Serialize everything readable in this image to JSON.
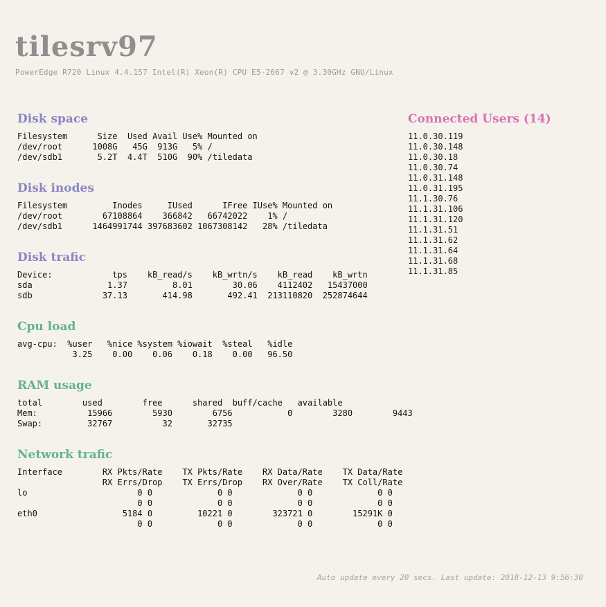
{
  "header": {
    "hostname": "tilesrv97",
    "sysinfo": "PowerEdge R720 Linux 4.4.157 Intel(R) Xeon(R) CPU E5-2667 v2 @ 3.30GHz GNU/Linux"
  },
  "disk_space": {
    "title": "Disk space",
    "text": "Filesystem      Size  Used Avail Use% Mounted on\n/dev/root      1008G   45G  913G   5% /\n/dev/sdb1       5.2T  4.4T  510G  90% /tiledata"
  },
  "disk_inodes": {
    "title": "Disk inodes",
    "text": "Filesystem         Inodes     IUsed      IFree IUse% Mounted on\n/dev/root        67108864    366842   66742022    1% /\n/dev/sdb1      1464991744 397683602 1067308142   28% /tiledata"
  },
  "disk_trafic": {
    "title": "Disk trafic",
    "text": "Device:            tps    kB_read/s    kB_wrtn/s    kB_read    kB_wrtn\nsda               1.37         8.01        30.06    4112402   15437000\nsdb              37.13       414.98       492.41  213110820  252874644"
  },
  "cpu_load": {
    "title": "Cpu load",
    "text": "avg-cpu:  %user   %nice %system %iowait  %steal   %idle\n           3.25    0.00    0.06    0.18    0.00   96.50"
  },
  "ram_usage": {
    "title": "RAM usage",
    "text": "total        used        free      shared  buff/cache   available\nMem:          15966        5930        6756           0        3280        9443\nSwap:         32767          32       32735"
  },
  "network_trafic": {
    "title": "Network trafic",
    "text": "Interface        RX Pkts/Rate    TX Pkts/Rate    RX Data/Rate    TX Data/Rate\n                 RX Errs/Drop    TX Errs/Drop    RX Over/Rate    TX Coll/Rate\nlo                      0 0             0 0             0 0             0 0\n                        0 0             0 0             0 0             0 0\neth0                 5184 0         10221 0        323721 0        15291K 0\n                        0 0             0 0             0 0             0 0"
  },
  "connected_users": {
    "title": "Connected Users (14)",
    "ips": [
      "11.0.30.119",
      "11.0.30.148",
      "11.0.30.18",
      "11.0.30.74",
      "11.0.31.148",
      "11.0.31.195",
      "11.1.30.76",
      "11.1.31.106",
      "11.1.31.120",
      "11.1.31.51",
      "11.1.31.62",
      "11.1.31.64",
      "11.1.31.68",
      "11.1.31.85"
    ]
  },
  "footer": {
    "text": "Auto update every 20 secs. Last update: 2018-12-13 9:56:30"
  },
  "colors": {
    "background": "#f5f2eb",
    "hostname": "#8f8f8f",
    "disk_titles": "#8a85c7",
    "system_titles": "#64b38c",
    "users_title": "#d873b3"
  }
}
